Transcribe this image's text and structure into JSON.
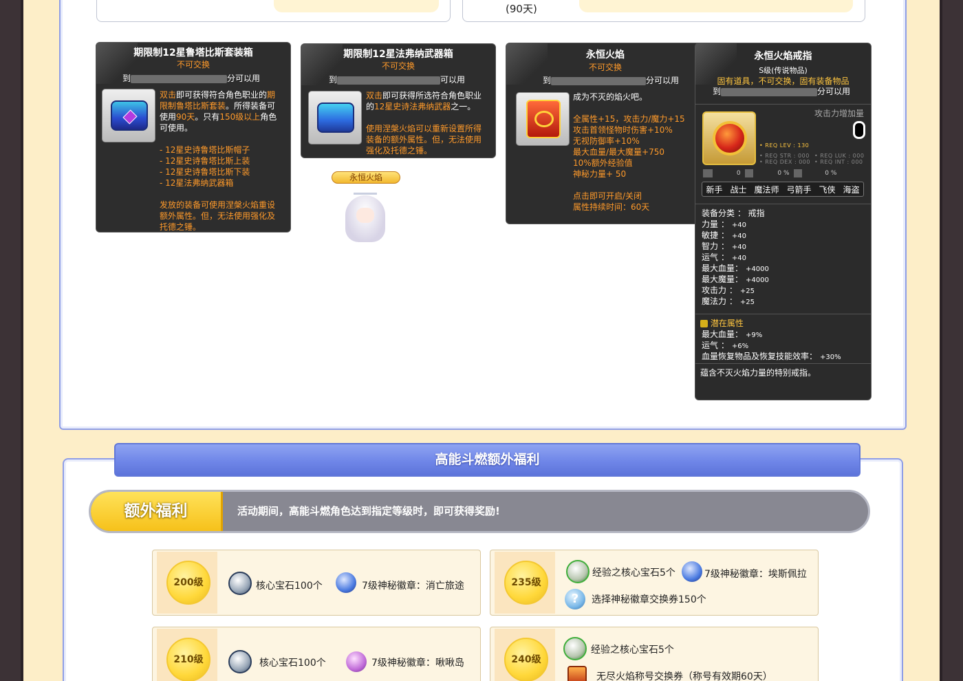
{
  "top": {
    "prev_suffix": "(90天)"
  },
  "tip1": {
    "title": "期限制12星鲁塔比斯套装箱",
    "trade": "不可交换",
    "to": "到",
    "usable": "分可以用",
    "desc": [
      {
        "parts": [
          {
            "t": "双击",
            "c": "org"
          },
          {
            "t": "即可获得符合角色职业的",
            "c": "w"
          },
          {
            "t": "期",
            "c": "org"
          }
        ]
      },
      {
        "parts": [
          {
            "t": "限制鲁塔比斯套装",
            "c": "org"
          },
          {
            "t": "。所得装备可",
            "c": "w"
          }
        ]
      },
      {
        "parts": [
          {
            "t": "使用",
            "c": "w"
          },
          {
            "t": "90天",
            "c": "org"
          },
          {
            "t": "。只有",
            "c": "w"
          },
          {
            "t": "150级以上",
            "c": "org"
          },
          {
            "t": "角色",
            "c": "w"
          }
        ]
      },
      {
        "parts": [
          {
            "t": "可使用。",
            "c": "w"
          }
        ]
      }
    ],
    "list": [
      "- 12星史诗鲁塔比斯帽子",
      "- 12星史诗鲁塔比斯上装",
      "- 12星史诗鲁塔比斯下装",
      "- 12星法弗纳武器箱"
    ],
    "note": [
      "发放的装备可使用涅槃火焰重设",
      "额外属性。但，无法使用强化及",
      "托德之锤。"
    ]
  },
  "tip2": {
    "title": "期限制12星法弗纳武器箱",
    "trade": "不可交换",
    "to": "到",
    "usable": "可以用",
    "desc": [
      {
        "parts": [
          {
            "t": "双击",
            "c": "org"
          },
          {
            "t": "即可获得所选符合角色职业",
            "c": "w"
          }
        ]
      },
      {
        "parts": [
          {
            "t": "的",
            "c": "w"
          },
          {
            "t": "12星史诗法弗纳武器",
            "c": "org"
          },
          {
            "t": "之一。",
            "c": "w"
          }
        ]
      }
    ],
    "note": [
      "使用涅槃火焰可以重新设置所得",
      "装备的额外属性。但，无法使用",
      "强化及托德之锤。"
    ]
  },
  "avatar": {
    "name_tag": "永恒火焰"
  },
  "tip3": {
    "title": "永恒火焰",
    "trade": "不可交换",
    "to": "到",
    "usable": "分可以用",
    "desc": "成为不灭的焰火吧。",
    "stats": [
      "全属性+15，攻击力/魔力+15",
      "攻击首领怪物时伤害+10%",
      "无视防御率+10%",
      "最大血量/最大魔量+750",
      "10%额外经验值",
      "神秘力量+ 50"
    ],
    "footer": [
      "点击即可开启/关闭",
      "属性持续时间：60天"
    ]
  },
  "tip4": {
    "title": "永恒火焰戒指",
    "grade": "S级(传说物品)",
    "flags": "固有道具，不可交换，固有装备物品",
    "to": "到",
    "usable": "分可以用",
    "atk_inc_label": "攻击力增加量",
    "req_lev": "• REQ LEV : 130",
    "req": [
      "• REQ STR : 000",
      "• REQ LUK : 000",
      "• REQ DEX : 000",
      "• REQ INT : 000"
    ],
    "small_vals": [
      "0",
      "0 %",
      "0 %"
    ],
    "classes": [
      "新手",
      "战士",
      "魔法师",
      "弓箭手",
      "飞侠",
      "海盗"
    ],
    "stats": [
      {
        "k": "装备分类 ： 戒指",
        "v": ""
      },
      {
        "k": "力量 ：",
        "v": "+40"
      },
      {
        "k": "敏捷 ：",
        "v": "+40"
      },
      {
        "k": "智力 ：",
        "v": "+40"
      },
      {
        "k": "运气 ：",
        "v": "+40"
      },
      {
        "k": "最大血量：",
        "v": "+4000"
      },
      {
        "k": "最大魔量：",
        "v": "+4000"
      },
      {
        "k": "攻击力 ：",
        "v": "+25"
      },
      {
        "k": "魔法力 ：",
        "v": "+25"
      }
    ],
    "potential_label": "潜在属性",
    "potential": [
      {
        "k": "最大血量：",
        "v": "+9%"
      },
      {
        "k": "运气 ：",
        "v": "+6%"
      },
      {
        "k": "血量恢复物品及恢复技能效率：",
        "v": "+30%"
      }
    ],
    "desc": "蕴含不灭火焰力量的特别戒指。"
  },
  "section": {
    "banner": "高能斗燃额外福利",
    "tag": "额外福利",
    "text": "活动期间，高能斗燃角色达到指定等级时，即可获得奖励!"
  },
  "rewards": {
    "r200": {
      "level": "200级",
      "a": "核心宝石100个",
      "b": "7级神秘徽章：消亡旅途"
    },
    "r235": {
      "level": "235级",
      "a": "经验之核心宝石5个",
      "b": "7级神秘徽章：埃斯佩拉",
      "c": "选择神秘徽章交换券150个"
    },
    "r210": {
      "level": "210级",
      "a": "核心宝石100个",
      "b": "7级神秘徽章：啾啾岛"
    },
    "r240": {
      "level": "240级",
      "a": "经验之核心宝石5个",
      "b": "无尽火焰称号交换券（称号有效期60天）"
    }
  },
  "colors": {
    "accent_blue": "#6f86e8",
    "gold": "#f6c11a",
    "orange_text": "#ff9a2a",
    "tooltip_bg": "#2d2d2d"
  }
}
